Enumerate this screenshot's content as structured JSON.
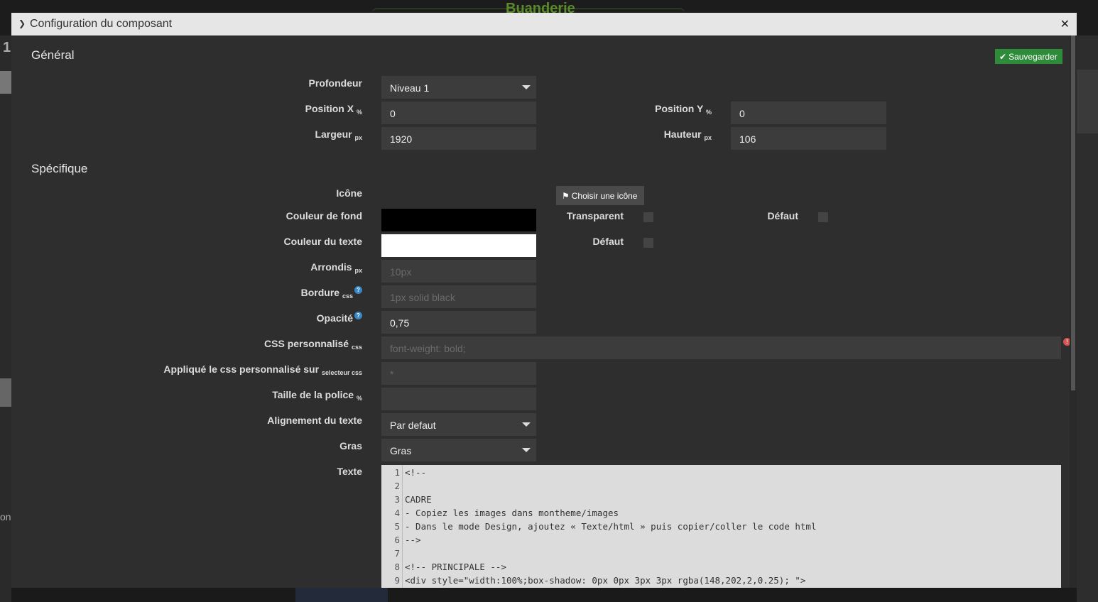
{
  "background": {
    "page_title": "Buanderie",
    "left_number": "1",
    "left_text": "on"
  },
  "modal": {
    "title": "Configuration du composant",
    "save_label": "Sauvegarder",
    "general": {
      "heading": "Général",
      "depth_label": "Profondeur",
      "depth_value": "Niveau 1",
      "posx_label": "Position X",
      "posx_unit": "%",
      "posx_value": "0",
      "posy_label": "Position Y",
      "posy_unit": "%",
      "posy_value": "0",
      "width_label": "Largeur",
      "width_unit": "px",
      "width_value": "1920",
      "height_label": "Hauteur",
      "height_unit": "px",
      "height_value": "106"
    },
    "specific": {
      "heading": "Spécifique",
      "icon_label": "Icône",
      "icon_button": "Choisir une icône",
      "bg_color_label": "Couleur de fond",
      "bg_color": "#000000",
      "transparent_label": "Transparent",
      "default_label_1": "Défaut",
      "text_color_label": "Couleur du texte",
      "text_color": "#ffffff",
      "default_label_2": "Défaut",
      "radius_label": "Arrondis",
      "radius_unit": "px",
      "radius_placeholder": "10px",
      "border_label": "Bordure",
      "border_unit": "css",
      "border_placeholder": "1px solid black",
      "opacity_label": "Opacité",
      "opacity_value": "0,75",
      "css_label": "CSS personnalisé",
      "css_unit": "css",
      "css_placeholder": "font-weight: bold;",
      "apply_label": "Appliqué le css personnalisé sur",
      "apply_unit": "selecteur css",
      "apply_placeholder": "*",
      "fontsize_label": "Taille de la police",
      "fontsize_unit": "%",
      "fontsize_value": "",
      "align_label": "Alignement du texte",
      "align_value": "Par defaut",
      "bold_label": "Gras",
      "bold_value": "Gras",
      "text_label": "Texte",
      "code_lines": [
        "<!--",
        "",
        "CADRE",
        "- Copiez les images dans montheme/images",
        "- Dans le mode Design, ajoutez « Texte/html » puis copier/coller le code html",
        "-->",
        "",
        "<!-- PRINCIPALE -->",
        "<div style=\"width:100%;box-shadow: 0px 0px 3px 3px rgba(148,202,2,0.25); \">"
      ]
    }
  }
}
